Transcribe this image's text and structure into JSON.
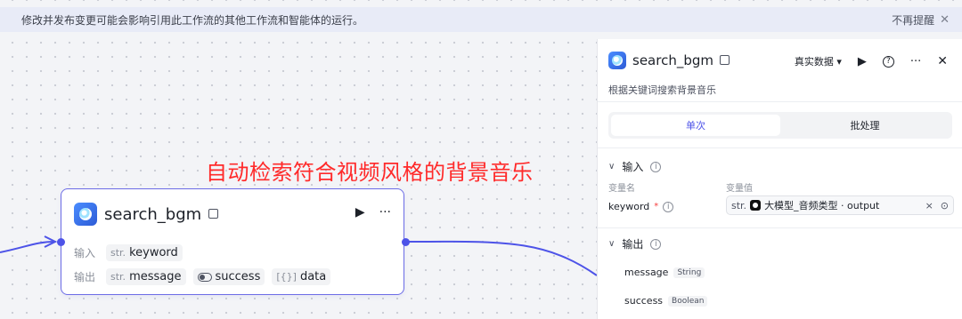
{
  "banner": {
    "message": "修改并发布变更可能会影响引用此工作流的其他工作流和智能体的运行。",
    "dismiss_label": "不再提醒"
  },
  "annotation": "自动检索符合视频风格的背景音乐",
  "node": {
    "title": "search_bgm",
    "input_label": "输入",
    "output_label": "输出",
    "inputs": [
      {
        "type": "str.",
        "name": "keyword"
      }
    ],
    "outputs": [
      {
        "type": "str.",
        "name": "message"
      },
      {
        "type": "toggle",
        "name": "success"
      },
      {
        "type": "[{}]",
        "name": "data"
      }
    ]
  },
  "panel": {
    "title": "search_bgm",
    "run_mode": "真实数据",
    "description": "根据关键词搜索背景音乐",
    "tabs": [
      {
        "label": "单次",
        "active": true
      },
      {
        "label": "批处理",
        "active": false
      }
    ],
    "input_section": {
      "title": "输入",
      "col_name": "变量名",
      "col_value": "变量值",
      "params": [
        {
          "name": "keyword",
          "required_mark": "*",
          "type": "str.",
          "source": "大模型_音频类型 · output"
        }
      ]
    },
    "output_section": {
      "title": "输出",
      "items": [
        {
          "name": "message",
          "type": "String"
        },
        {
          "name": "success",
          "type": "Boolean"
        }
      ]
    }
  },
  "colors": {
    "accent": "#4d53e8",
    "annotation": "#ff2a2a",
    "node_border": "#6c6ce6"
  },
  "icons": {
    "app": "app-icon",
    "save": "save-icon",
    "run": "play-icon",
    "more": "more-icon",
    "help": "help-icon",
    "close": "close-icon",
    "chevron": "chevron-down-icon",
    "info": "info-icon"
  }
}
